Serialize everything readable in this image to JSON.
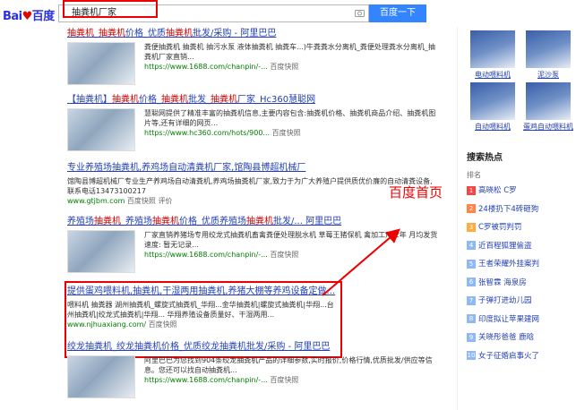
{
  "search": {
    "query": "抽粪机厂家",
    "button_label": "百度一下",
    "logo_brand": "Bai",
    "logo_du": "du",
    "logo_cn": "百度"
  },
  "results": [
    {
      "title_parts": [
        "抽粪机",
        "_",
        "抽粪机",
        "价格_优质",
        "抽粪机",
        "批发/采购 - 阿里巴巴"
      ],
      "desc": "粪便抽粪机 抽粪机 抽污水泵 液体抽粪机 抽粪车...)牛粪粪水分离机_粪便处理粪水分离机_抽粪机厂家直销...",
      "url": "https://www.1688.com/chanpin/-...",
      "snapshot": "百度快照"
    },
    {
      "title_parts": [
        "【抽粪机】",
        "抽粪机",
        "价格_",
        "抽粪机",
        "批发_",
        "抽粪机",
        "厂家_Hc360慧聪网"
      ],
      "desc": "慧聪网提供了精准丰富的抽粪机信息,主要内容包含:抽粪机价格、抽粪机商品介绍、抽粪机图片等,还有详细的网页...",
      "url": "https://www.hc360.com/hots/900...",
      "snapshot": "百度快照"
    },
    {
      "title": "专业养殖场抽粪机,养鸡场自动清粪机厂家,馆陶县博超机械厂",
      "desc": "馆陶县博超机械厂专业生产养鸡场自动清粪机,养鸡场抽粪机厂家,致力于为广大养殖户提供质优价廉的自动清粪设备,联系电话13473100217",
      "url": "www.gtjbm.com",
      "snapshot": "百度快照",
      "meta": "评价"
    },
    {
      "title_parts": [
        "养殖场",
        "抽粪机",
        "_养殖场",
        "抽粪机",
        "价格_优质养殖场",
        "抽粪机",
        "批发/... 阿里巴巴"
      ],
      "desc": "厂家直销养猪场专用绞龙式抽粪机畜禽粪便处理脱水机 草莓王猪保机 禽加工厂 2年 月均发货速度: 暂无记录...",
      "url": "https://www.1688.com/chanpin/-...",
      "snapshot": "百度快照"
    },
    {
      "title": "提供蛋鸡喂料机,抽粪机,干湿两用抽粪机,养猪大棚等养鸡设备定做...",
      "desc": "喂料机 抽粪器 湖州抽粪机_螺旋式抽粪机_华翔...金华抽粪机|螺旋式抽粪机|华翔...台州抽粪机|绞龙式抽粪机|华翔... 华翔养殖设备质量好、干湿两用...",
      "url": "www.njhuaxiang.com/",
      "snapshot": "百度快照"
    },
    {
      "title": "绞龙抽粪机_绞龙抽粪机价格_优质绞龙抽粪机批发/采购 - 阿里巴巴",
      "desc": "阿里巴巴为您找到904条绞龙抽粪机产品的详细参数,实时报价,价格行情,优质批发/供应等信息。您还可以找自动抽粪机...",
      "url": "https://www.1688.com/chanpin/-...",
      "snapshot": "百度快照"
    }
  ],
  "annotation": {
    "label": "百度首页"
  },
  "sidebar": {
    "products": [
      {
        "name": "电动喂料机"
      },
      {
        "name": "泥沙泵"
      },
      {
        "name": "自动喂料机"
      },
      {
        "name": "蛋鸡自动喂料机"
      }
    ],
    "hot_title": "搜索热点",
    "hot_sub": "排名",
    "hot_items": [
      {
        "num": "1",
        "label": "高晓松 C罗"
      },
      {
        "num": "2",
        "label": "24楼扔下4砖砸狗"
      },
      {
        "num": "3",
        "label": "C罗被罚判罚"
      },
      {
        "num": "4",
        "label": "近百程狐狸偷盗"
      },
      {
        "num": "5",
        "label": "王者荣耀外挂案判"
      },
      {
        "num": "6",
        "label": "张智霖 海泉房"
      },
      {
        "num": "7",
        "label": "子弹打进幼儿园"
      },
      {
        "num": "8",
        "label": "印度拟让苹果建网"
      },
      {
        "num": "9",
        "label": "关晓彤爸爸 鹿晗"
      },
      {
        "num": "10",
        "label": "女子征婚启事火了"
      }
    ]
  }
}
